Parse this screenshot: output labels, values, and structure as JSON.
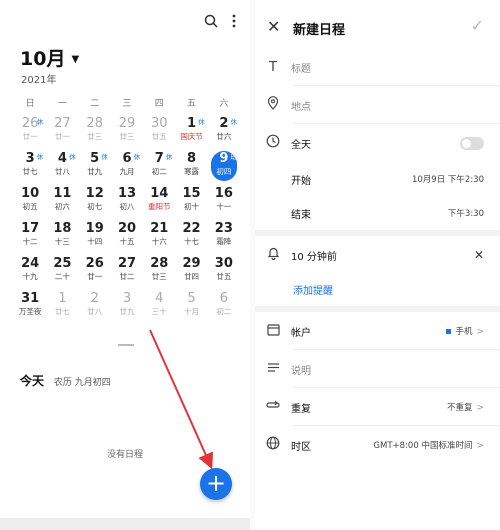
{
  "calendar": {
    "month_label": "10月",
    "year_label": "2021年",
    "weekdays": [
      "日",
      "一",
      "二",
      "三",
      "四",
      "五",
      "六"
    ],
    "days": [
      {
        "d": "26",
        "l": "廿一",
        "tag": "休",
        "muted": true
      },
      {
        "d": "27",
        "l": "廿一",
        "muted": true
      },
      {
        "d": "28",
        "l": "廿三",
        "muted": true
      },
      {
        "d": "29",
        "l": "廿三",
        "muted": true
      },
      {
        "d": "30",
        "l": "廿五",
        "muted": true
      },
      {
        "d": "1",
        "l": "国庆节",
        "tag": "休",
        "red": true
      },
      {
        "d": "2",
        "l": "廿六",
        "tag": "休"
      },
      {
        "d": "3",
        "l": "廿七",
        "tag": "休"
      },
      {
        "d": "4",
        "l": "廿八",
        "tag": "休"
      },
      {
        "d": "5",
        "l": "廿九",
        "tag": "休"
      },
      {
        "d": "6",
        "l": "九月",
        "tag": "休"
      },
      {
        "d": "7",
        "l": "初二",
        "tag": "休"
      },
      {
        "d": "8",
        "l": "寒露"
      },
      {
        "d": "9",
        "l": "初四",
        "tag": "班",
        "today": true
      },
      {
        "d": "10",
        "l": "初五"
      },
      {
        "d": "11",
        "l": "初六"
      },
      {
        "d": "12",
        "l": "初七"
      },
      {
        "d": "13",
        "l": "初八"
      },
      {
        "d": "14",
        "l": "重阳节",
        "red": true
      },
      {
        "d": "15",
        "l": "初十"
      },
      {
        "d": "16",
        "l": "十一"
      },
      {
        "d": "17",
        "l": "十二"
      },
      {
        "d": "18",
        "l": "十三"
      },
      {
        "d": "19",
        "l": "十四"
      },
      {
        "d": "20",
        "l": "十五"
      },
      {
        "d": "21",
        "l": "十六"
      },
      {
        "d": "22",
        "l": "十七"
      },
      {
        "d": "23",
        "l": "霜降"
      },
      {
        "d": "24",
        "l": "十九"
      },
      {
        "d": "25",
        "l": "二十"
      },
      {
        "d": "26",
        "l": "廿一"
      },
      {
        "d": "27",
        "l": "廿二"
      },
      {
        "d": "28",
        "l": "廿三"
      },
      {
        "d": "29",
        "l": "廿四"
      },
      {
        "d": "30",
        "l": "廿五"
      },
      {
        "d": "31",
        "l": "万圣夜"
      },
      {
        "d": "1",
        "l": "廿七",
        "muted": true
      },
      {
        "d": "2",
        "l": "廿八",
        "muted": true
      },
      {
        "d": "3",
        "l": "廿九",
        "muted": true
      },
      {
        "d": "4",
        "l": "三十",
        "muted": true
      },
      {
        "d": "5",
        "l": "十月",
        "muted": true
      },
      {
        "d": "6",
        "l": "初二",
        "muted": true
      }
    ],
    "today_title": "今天",
    "today_lunar": "农历 九月初四",
    "no_schedule": "没有日程",
    "fab_label": "+"
  },
  "editor": {
    "title": "新建日程",
    "title_placeholder": "标题",
    "location_placeholder": "地点",
    "all_day_label": "全天",
    "start_label": "开始",
    "start_value": "10月9日 下午2:30",
    "end_label": "结束",
    "end_value": "下午3:30",
    "reminder_label": "10 分钟前",
    "add_reminder": "添加提醒",
    "account_label": "帐户",
    "account_value": "手机",
    "description_label": "说明",
    "repeat_label": "重复",
    "repeat_value": "不重复",
    "timezone_label": "时区",
    "timezone_value": "GMT+8:00 中国标准时间"
  },
  "colors": {
    "accent": "#1a73e8",
    "arrow": "#e0353a"
  },
  "icons": [
    "search-icon",
    "more-icon",
    "close-icon",
    "check-icon",
    "text-icon",
    "location-icon",
    "clock-icon",
    "bell-icon",
    "calendar-icon",
    "description-icon",
    "repeat-icon",
    "globe-icon",
    "plus-icon"
  ]
}
